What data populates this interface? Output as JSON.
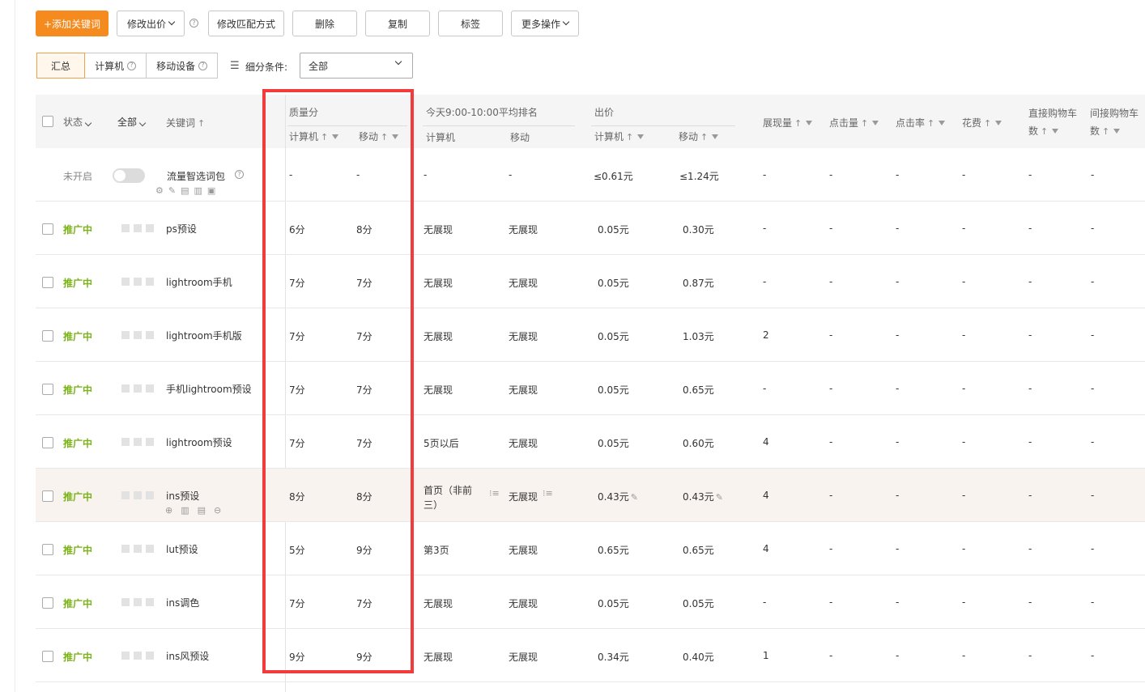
{
  "toolbar": {
    "add_keyword": "+添加关键词",
    "modify_bid": "修改出价",
    "modify_match": "修改匹配方式",
    "delete": "删除",
    "copy": "复制",
    "tag": "标签",
    "more_actions": "更多操作",
    "help_mark": "?"
  },
  "device_tabs": {
    "summary": "汇总",
    "computer": "计算机",
    "mobile": "移动设备"
  },
  "filter": {
    "label": "细分条件:",
    "value": "全部"
  },
  "headers": {
    "status": "状态",
    "all": "全部",
    "keyword": "关键词",
    "quality": "质量分",
    "quality_pc": "计算机",
    "quality_mobile": "移动",
    "rank": "今天9:00-10:00平均排名",
    "rank_pc": "计算机",
    "rank_mobile": "移动",
    "bid": "出价",
    "bid_pc": "计算机",
    "bid_mobile": "移动",
    "impressions": "展现量",
    "clicks": "点击量",
    "ctr": "点击率",
    "cost": "花费",
    "direct_cart_1": "直接购物车",
    "direct_cart_2": "数",
    "indirect_cart_1": "间接购物车",
    "indirect_cart_2": "数",
    "up_arrow": "↑"
  },
  "package_row": {
    "status": "未开启",
    "keyword": "流量智选词包",
    "quality_pc": "-",
    "quality_mobile": "-",
    "rank_pc": "-",
    "rank_mobile": "-",
    "bid_pc": "≤0.61元",
    "bid_mobile": "≤1.24元",
    "impressions": "-",
    "clicks": "-",
    "ctr": "-",
    "cost": "-",
    "direct": "-",
    "indirect": "-"
  },
  "rows": [
    {
      "status": "推广中",
      "keyword": "ps预设",
      "q_pc": "6分",
      "q_m": "8分",
      "r_pc": "无展现",
      "r_m": "无展现",
      "b_pc": "0.05元",
      "b_m": "0.30元",
      "imp": "-",
      "clk": "-",
      "ctr": "-",
      "cost": "-",
      "direct": "-",
      "indirect": "-"
    },
    {
      "status": "推广中",
      "keyword": "lightroom手机",
      "q_pc": "7分",
      "q_m": "7分",
      "r_pc": "无展现",
      "r_m": "无展现",
      "b_pc": "0.05元",
      "b_m": "0.87元",
      "imp": "-",
      "clk": "-",
      "ctr": "-",
      "cost": "-",
      "direct": "-",
      "indirect": "-"
    },
    {
      "status": "推广中",
      "keyword": "lightroom手机版",
      "q_pc": "7分",
      "q_m": "7分",
      "r_pc": "无展现",
      "r_m": "无展现",
      "b_pc": "0.05元",
      "b_m": "1.03元",
      "imp": "2",
      "clk": "-",
      "ctr": "-",
      "cost": "-",
      "direct": "-",
      "indirect": "-"
    },
    {
      "status": "推广中",
      "keyword": "手机lightroom预设",
      "q_pc": "7分",
      "q_m": "7分",
      "r_pc": "无展现",
      "r_m": "无展现",
      "b_pc": "0.05元",
      "b_m": "0.65元",
      "imp": "-",
      "clk": "-",
      "ctr": "-",
      "cost": "-",
      "direct": "-",
      "indirect": "-"
    },
    {
      "status": "推广中",
      "keyword": "lightroom预设",
      "q_pc": "7分",
      "q_m": "7分",
      "r_pc": "5页以后",
      "r_m": "无展现",
      "b_pc": "0.05元",
      "b_m": "0.60元",
      "imp": "4",
      "clk": "-",
      "ctr": "-",
      "cost": "-",
      "direct": "-",
      "indirect": "-"
    },
    {
      "status": "推广中",
      "keyword": "ins预设",
      "q_pc": "8分",
      "q_m": "8分",
      "r_pc": "首页（非前",
      "r_pc2": "三）",
      "r_m": "无展现",
      "b_pc": "0.43元",
      "b_m": "0.43元",
      "imp": "4",
      "clk": "-",
      "ctr": "-",
      "cost": "-",
      "direct": "-",
      "indirect": "-"
    },
    {
      "status": "推广中",
      "keyword": "lut预设",
      "q_pc": "5分",
      "q_m": "9分",
      "r_pc": "第3页",
      "r_m": "无展现",
      "b_pc": "0.65元",
      "b_m": "0.65元",
      "imp": "4",
      "clk": "-",
      "ctr": "-",
      "cost": "-",
      "direct": "-",
      "indirect": "-"
    },
    {
      "status": "推广中",
      "keyword": "ins调色",
      "q_pc": "7分",
      "q_m": "7分",
      "r_pc": "无展现",
      "r_m": "无展现",
      "b_pc": "0.05元",
      "b_m": "0.05元",
      "imp": "-",
      "clk": "-",
      "ctr": "-",
      "cost": "-",
      "direct": "-",
      "indirect": "-"
    },
    {
      "status": "推广中",
      "keyword": "ins风预设",
      "q_pc": "9分",
      "q_m": "9分",
      "r_pc": "无展现",
      "r_m": "无展现",
      "b_pc": "0.34元",
      "b_m": "0.40元",
      "imp": "1",
      "clk": "-",
      "ctr": "-",
      "cost": "-",
      "direct": "-",
      "indirect": "-"
    }
  ]
}
